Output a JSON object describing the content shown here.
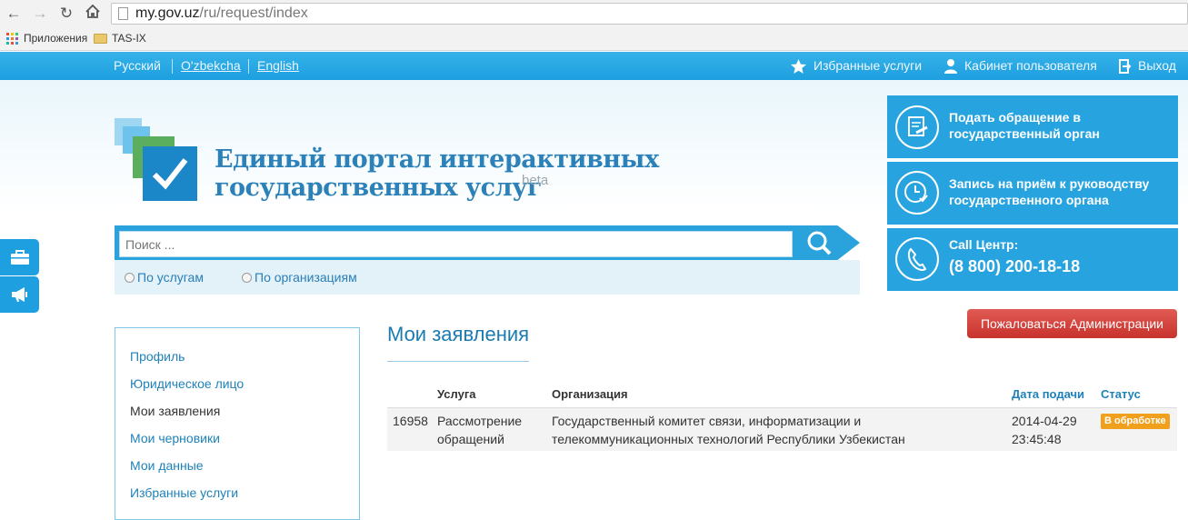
{
  "browser": {
    "url_host": "my.gov.uz",
    "url_path": "/ru/request/index",
    "bookmarks": [
      {
        "label": "Приложения"
      },
      {
        "label": "TAS-IX"
      }
    ]
  },
  "topbar": {
    "languages": [
      {
        "label": "Русский"
      },
      {
        "label": "O'zbekcha"
      },
      {
        "label": "English"
      }
    ],
    "favorites_label": "Избранные услуги",
    "cabinet_label": "Кабинет пользователя",
    "logout_label": "Выход"
  },
  "header": {
    "title_line1": "Единый портал интерактивных",
    "title_line2": "государственных услуг",
    "beta": "beta"
  },
  "search": {
    "placeholder": "Поиск ...",
    "option_services": "По услугам",
    "option_orgs": "По организациям"
  },
  "tiles": {
    "appeal_line1": "Подать обращение в",
    "appeal_line2": "государственный орган",
    "appointment_line1": "Запись на приём к руководству",
    "appointment_line2": "государственного органа",
    "callcenter_label": "Call Центр:",
    "callcenter_phone": "(8 800) 200-18-18"
  },
  "sidebar": {
    "items": [
      {
        "label": "Профиль"
      },
      {
        "label": "Юридическое лицо"
      },
      {
        "label": "Мои заявления"
      },
      {
        "label": "Мои черновики"
      },
      {
        "label": "Мои данные"
      },
      {
        "label": "Избранные услуги"
      }
    ]
  },
  "main": {
    "title": "Мои заявления",
    "complaint_button": "Пожаловаться Администрации",
    "table": {
      "headers": {
        "service": "Услуга",
        "organization": "Организация",
        "date": "Дата подачи",
        "status": "Статус"
      },
      "rows": [
        {
          "id": "16958",
          "service_line1": "Рассмотрение",
          "service_line2": "обращений",
          "org_line1": "Государственный комитет связи, информатизации и",
          "org_line2": "телекоммуникационных технологий Республики Узбекистан",
          "date_line1": "2014-04-29",
          "date_line2": "23:45:48",
          "status": "В обработке"
        }
      ]
    }
  },
  "colors": {
    "brand_blue": "#27a3e0",
    "link_blue": "#1e82b8",
    "danger": "#d0403a",
    "status_orange": "#f0a01c"
  }
}
